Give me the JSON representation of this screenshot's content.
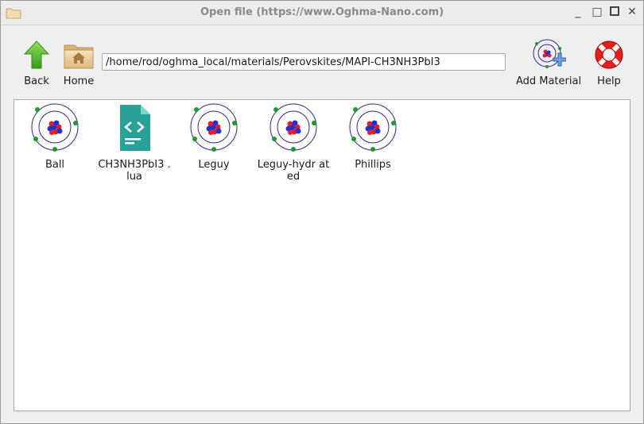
{
  "window": {
    "title": "Open file (https://www.Oghma-Nano.com)",
    "minimize": "_",
    "maximize": "□",
    "close": "✕"
  },
  "toolbar": {
    "back_label": "Back",
    "home_label": "Home",
    "path_value": "/home/rod/oghma_local/materials/Perovskites/MAPI-CH3NH3PbI3",
    "add_material_label": "Add Material",
    "help_label": "Help"
  },
  "files": [
    {
      "name": "Ball",
      "icon": "atom-icon"
    },
    {
      "name": "CH3NH3PbI3 .lua",
      "icon": "code-file-icon"
    },
    {
      "name": "Leguy",
      "icon": "atom-icon"
    },
    {
      "name": "Leguy-hydr ated",
      "icon": "atom-icon"
    },
    {
      "name": "Phillips",
      "icon": "atom-icon"
    }
  ],
  "colors": {
    "back_arrow": "#5cb82e",
    "folder": "#e6c995",
    "help_ring": "#e02020",
    "code_file": "#2aa198",
    "atom_orbit": "#2a2a8a",
    "proton": "#e0202a",
    "neutron": "#2030d0",
    "electron": "#1f9a2a"
  }
}
